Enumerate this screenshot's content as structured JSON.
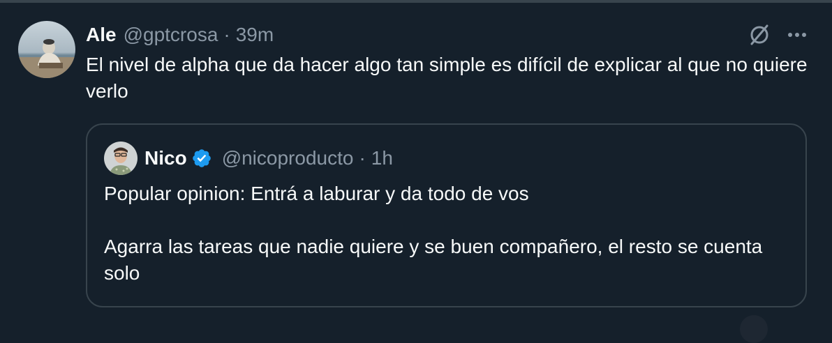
{
  "tweet": {
    "display_name": "Ale",
    "handle": "@gptcrosa",
    "separator": "·",
    "time": "39m",
    "text": "El nivel de alpha que da hacer algo tan simple es difícil de explicar al que no quiere verlo",
    "avatar_icon": "user-photo-avatar",
    "grok_icon": "grok-icon",
    "more_icon": "more-horizontal-icon"
  },
  "quote": {
    "display_name": "Nico",
    "verified": true,
    "verified_color": "#1d9bf0",
    "handle": "@nicoproducto",
    "separator": "·",
    "time": "1h",
    "text": "Popular opinion: Entrá a laburar y da todo de vos\n\nAgarra las tareas que nadie quiere y se buen compañero, el resto se cuenta solo",
    "avatar_icon": "user-photo-avatar"
  },
  "colors": {
    "background": "#15202b",
    "border": "#38444d",
    "text_primary": "#f7f9f9",
    "text_secondary": "#8b98a5",
    "accent": "#1d9bf0"
  }
}
